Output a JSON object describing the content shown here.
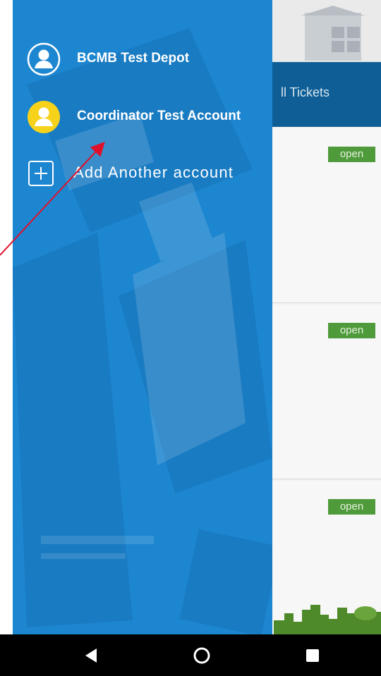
{
  "background_app": {
    "tab_label": "ll Tickets",
    "badges": [
      "open",
      "open",
      "open"
    ]
  },
  "drawer": {
    "accounts": [
      {
        "name": "BCMB Test Depot",
        "avatar_icon": "user-avatar-icon",
        "avatar_color": "#1d86d0"
      },
      {
        "name": "Coordinator Test Account",
        "avatar_icon": "user-avatar-icon",
        "avatar_color": "#f7d21b"
      }
    ],
    "add_account_label": "Add Another account",
    "add_icon": "plus-square-icon"
  },
  "system_nav": {
    "back_icon": "back-triangle-icon",
    "home_icon": "home-circle-icon",
    "recents_icon": "recents-square-icon"
  },
  "colors": {
    "drawer": "#1d86d0",
    "header_bar": "#0f5f96",
    "badge": "#4f9a3b",
    "annotation_arrow": "#e0102a"
  }
}
